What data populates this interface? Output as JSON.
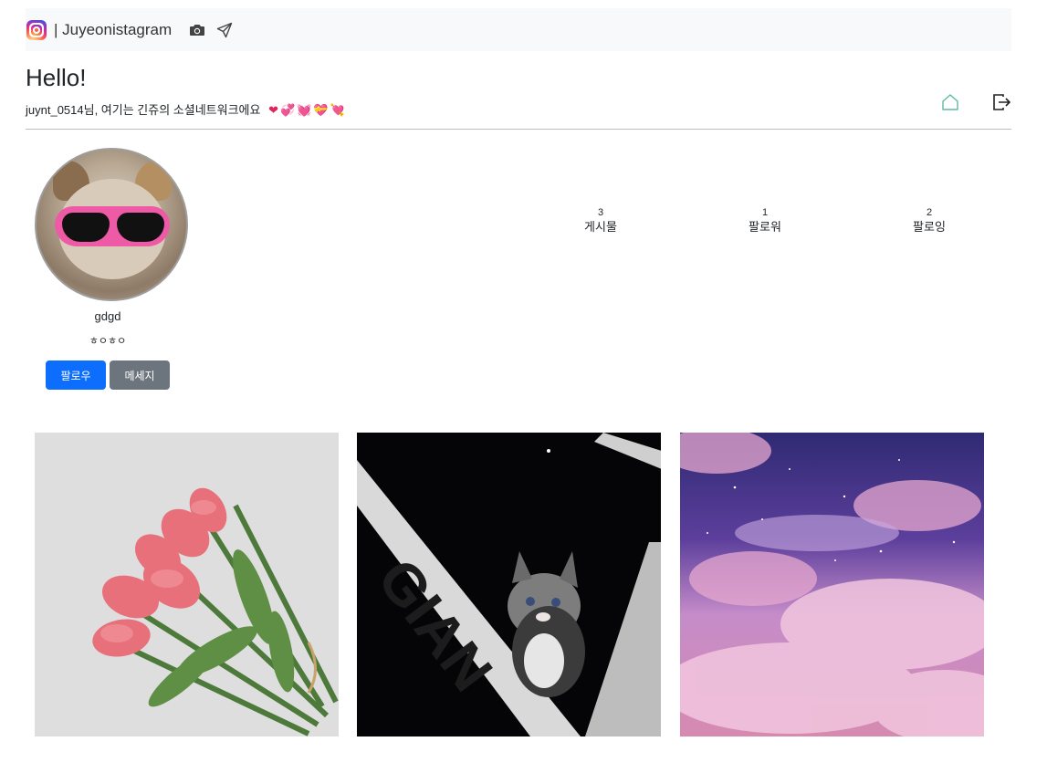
{
  "navbar": {
    "brand_text": "| Juyeonistagram",
    "icons": [
      "instagram-logo-icon",
      "camera-icon",
      "send-icon"
    ]
  },
  "header": {
    "greeting": "Hello!",
    "subtitle": "juynt_0514님, 여기는 긴쥬의 소셜네트워크에요",
    "hearts": "❤💞💓💝💘",
    "icons": [
      "home-icon",
      "logout-icon"
    ]
  },
  "profile": {
    "username": "gdgd",
    "bio": "ㅎㅇㅎㅇ",
    "follow_label": "팔로우",
    "message_label": "메세지"
  },
  "stats": [
    {
      "count": "3",
      "label": "게시물"
    },
    {
      "count": "1",
      "label": "팔로워"
    },
    {
      "count": "2",
      "label": "팔로잉"
    }
  ],
  "colors": {
    "primary_button": "#0d6efd",
    "secondary_button": "#6c757d",
    "navbar_bg": "#f8f9fa",
    "home_icon": "#5fb8a5"
  }
}
